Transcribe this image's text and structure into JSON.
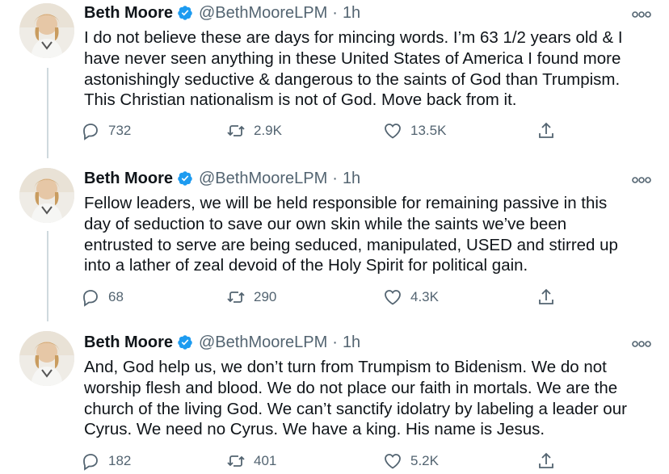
{
  "tweets": [
    {
      "author": "Beth Moore",
      "handle": "@BethMooreLPM",
      "time": "1h",
      "text": "I do not believe these are days for mincing words. I’m 63 1/2 years old & I\nhave never seen anything in these United States of America I found more\nastonishingly seductive & dangerous to the saints of God than Trumpism.\nThis Christian nationalism is not of God. Move back from it.",
      "replies": "732",
      "retweets": "2.9K",
      "likes": "13.5K"
    },
    {
      "author": "Beth Moore",
      "handle": "@BethMooreLPM",
      "time": "1h",
      "text": "Fellow leaders, we will be held responsible for remaining passive in this\nday of seduction to save our own skin while the saints we’ve been\nentrusted to serve are being seduced, manipulated, USED and stirred up\ninto a lather of zeal devoid of the Holy Spirit for political gain.",
      "replies": "68",
      "retweets": "290",
      "likes": "4.3K"
    },
    {
      "author": "Beth Moore",
      "handle": "@BethMooreLPM",
      "time": "1h",
      "text": "And, God help us, we don’t turn from Trumpism to Bidenism. We do not\nworship flesh and blood. We do not place our faith in mortals. We are the\nchurch of the living God. We can’t sanctify idolatry by labeling a leader our\nCyrus. We need no Cyrus. We have a king. His name is Jesus.",
      "replies": "182",
      "retweets": "401",
      "likes": "5.2K"
    }
  ],
  "separator": "·",
  "colors": {
    "text": "#0f1419",
    "secondary": "#536471",
    "verified": "#1d9bf0",
    "thread_line": "#cfd9de"
  }
}
